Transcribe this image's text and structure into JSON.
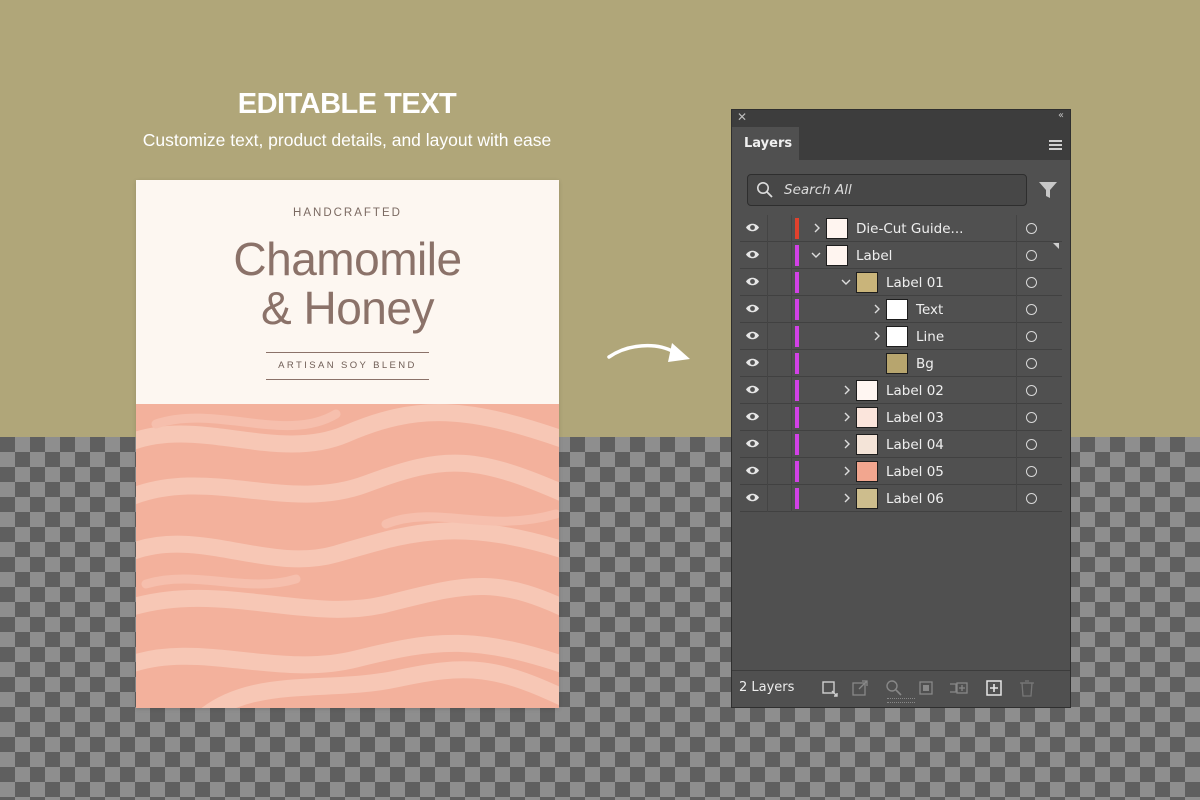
{
  "promo": {
    "title": "EDITABLE TEXT",
    "subtitle": "Customize text, product details, and layout with ease"
  },
  "label": {
    "kicker": "HANDCRAFTED",
    "title_line1": "Chamomile",
    "title_line2": "& Honey",
    "subtitle": "ARTISAN SOY BLEND"
  },
  "panel": {
    "tab": "Layers",
    "search_placeholder": "Search All",
    "layer_count": "2 Layers",
    "colors": {
      "bg": "#505050",
      "red_layer": "#e0412d",
      "magenta_layer": "#d241e6"
    },
    "rows": [
      {
        "name": "Die-Cut Guide...",
        "color": "#e0412d",
        "expand": "collapsed"
      },
      {
        "name": "Label",
        "color": "#d241e6",
        "expand": "expanded"
      },
      {
        "name": "Label 01",
        "color": "#d241e6",
        "expand": "expanded"
      },
      {
        "name": "Text",
        "color": "#d241e6",
        "expand": "collapsed"
      },
      {
        "name": "Line",
        "color": "#d241e6",
        "expand": "collapsed"
      },
      {
        "name": "Bg",
        "color": "#d241e6",
        "expand": "none"
      },
      {
        "name": "Label 02",
        "color": "#d241e6",
        "expand": "collapsed"
      },
      {
        "name": "Label 03",
        "color": "#d241e6",
        "expand": "collapsed"
      },
      {
        "name": "Label 04",
        "color": "#d241e6",
        "expand": "collapsed"
      },
      {
        "name": "Label 05",
        "color": "#d241e6",
        "expand": "collapsed"
      },
      {
        "name": "Label 06",
        "color": "#d241e6",
        "expand": "collapsed"
      }
    ]
  }
}
